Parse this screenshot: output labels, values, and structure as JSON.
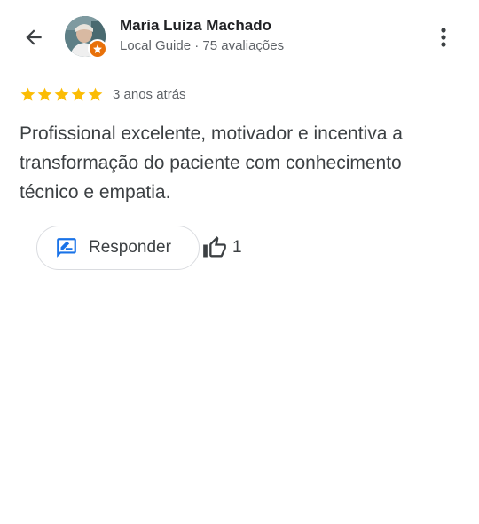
{
  "header": {
    "reviewer_name": "Maria Luiza Machado",
    "reviewer_subtitle": "Local Guide · 75 avaliações",
    "badge_icon": "local-guide-star-icon",
    "back_icon": "arrow-back-icon",
    "menu_icon": "more-vert-icon"
  },
  "review": {
    "rating": 5,
    "max_rating": 5,
    "star_color": "#fbbc04",
    "time_ago": "3 anos atrás",
    "text": "Profissional excelente, motivador e incentiva a transformação do paciente com conhecimento técnico e empatia."
  },
  "actions": {
    "reply_label": "Responder",
    "reply_icon": "rate-review-icon",
    "reply_icon_color": "#1a73e8",
    "like_icon": "thumb-up-outline-icon",
    "like_count": "1"
  }
}
